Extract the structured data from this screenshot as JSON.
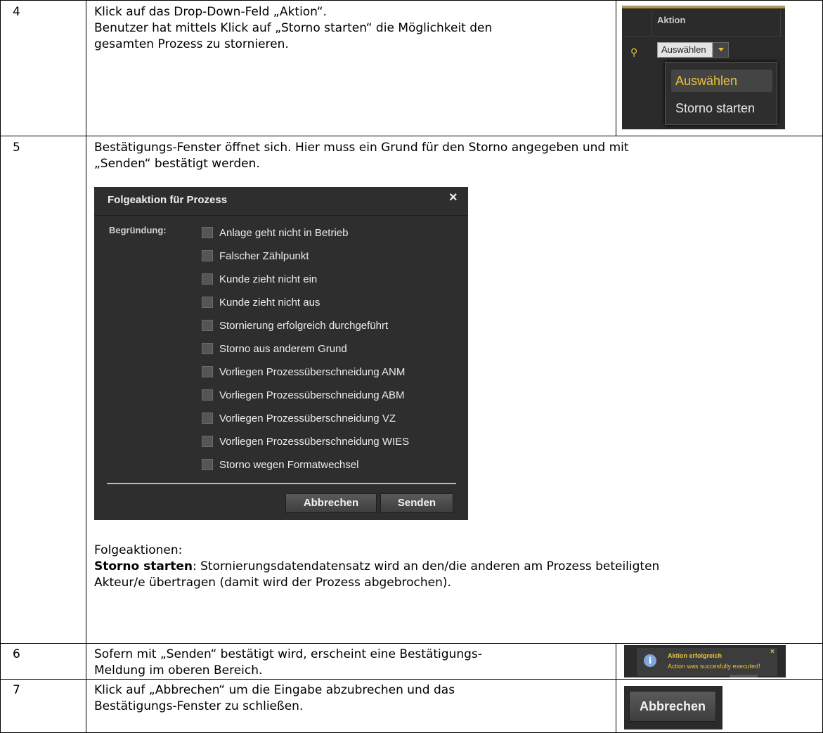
{
  "rows": [
    {
      "step": "4",
      "lines": [
        "Klick auf das Drop-Down-Feld „Aktion“.",
        "Benutzer hat mittels Klick auf „Storno starten“ die Möglichkeit den",
        "gesamten Prozess zu stornieren."
      ]
    },
    {
      "step": "5",
      "lines": [
        "Bestätigungs-Fenster öffnet sich. Hier muss ein Grund für den Storno angegeben und mit",
        "„Senden“ bestätigt werden."
      ],
      "followups_heading": "Folgeaktionen:",
      "followup_bold": "Storno starten",
      "followup_rest": ": Stornierungsdatendatensatz wird an den/die anderen am Prozess beteiligten",
      "followup_line2": "Akteur/e übertragen (damit wird der Prozess abgebrochen)."
    },
    {
      "step": "6",
      "lines": [
        "Sofern mit „Senden“ bestätigt wird, erscheint eine Bestätigungs-",
        "Meldung im oberen Bereich."
      ]
    },
    {
      "step": "7",
      "lines": [
        "Klick auf „Abbrechen“ um die Eingabe abzubrechen und das",
        "Bestätigungs-Fenster zu schließen."
      ]
    }
  ],
  "aktion_screenshot": {
    "header": "Aktion",
    "select_value": "Auswählen",
    "options": [
      "Auswählen",
      "Storno starten"
    ],
    "accent_color": "#e8c23a"
  },
  "dialog": {
    "title": "Folgeaktion für Prozess",
    "close_icon": "×",
    "reason_label": "Begründung:",
    "options": [
      "Anlage geht nicht in Betrieb",
      "Falscher Zählpunkt",
      "Kunde zieht nicht ein",
      "Kunde zieht nicht aus",
      "Stornierung erfolgreich durchgeführt",
      "Storno aus anderem Grund",
      "Vorliegen Prozessüberschneidung ANM",
      "Vorliegen Prozessüberschneidung ABM",
      "Vorliegen Prozessüberschneidung VZ",
      "Vorliegen Prozessüberschneidung WIES",
      "Storno wegen Formatwechsel"
    ],
    "cancel_label": "Abbrechen",
    "send_label": "Senden",
    "background": "#2e2e2e"
  },
  "notification": {
    "title": "Aktion erfolgreich",
    "message": "Action was succesfully executed!",
    "close_icon": "×",
    "info_icon": "i"
  },
  "cancel_button_screenshot": {
    "label": "Abbrechen"
  }
}
